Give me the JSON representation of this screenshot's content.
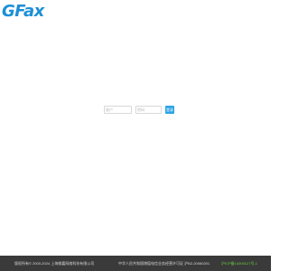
{
  "brand": {
    "logo_text": "GFax",
    "logo_color": "#1b8fd6"
  },
  "login": {
    "username_placeholder": "账户",
    "password_placeholder": "密码",
    "submit_label": "登录",
    "button_color": "#2aa3e6"
  },
  "footer": {
    "copyright": "版权所有© 2000-2024 上海微嘉网络科技有限公司",
    "license": "中华人民共和国增值电信业务经营许可证 沪B2-20060201",
    "icp": "沪ICP备14000127号-1",
    "background_color": "#3a3a3a",
    "icp_color": "#6ccf3e"
  }
}
